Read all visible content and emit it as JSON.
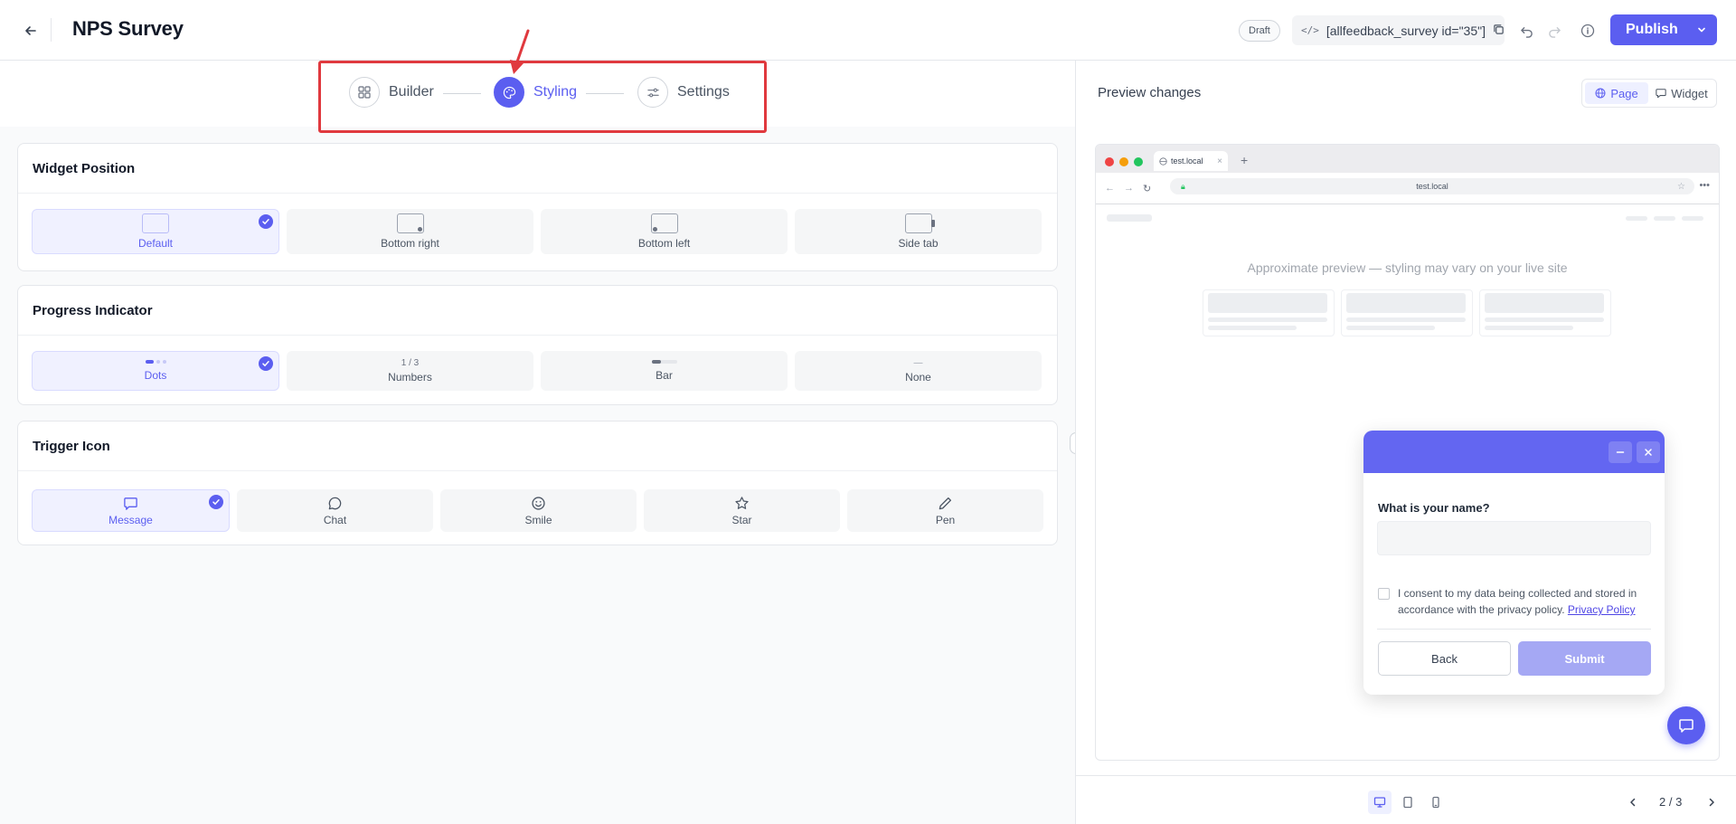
{
  "header": {
    "title": "NPS Survey",
    "status_badge": "Draft",
    "shortcode": "[allfeedback_survey id=\"35\"]",
    "publish_label": "Publish"
  },
  "steps": [
    {
      "label": "Builder",
      "icon": "grid-icon",
      "active": false
    },
    {
      "label": "Styling",
      "icon": "palette-icon",
      "active": true
    },
    {
      "label": "Settings",
      "icon": "sliders-icon",
      "active": false
    }
  ],
  "widget_position": {
    "title": "Widget Position",
    "options": [
      {
        "label": "Default",
        "selected": true
      },
      {
        "label": "Bottom right",
        "selected": false
      },
      {
        "label": "Bottom left",
        "selected": false
      },
      {
        "label": "Side tab",
        "selected": false
      }
    ]
  },
  "progress_indicator": {
    "title": "Progress Indicator",
    "options": [
      {
        "label": "Dots",
        "selected": true
      },
      {
        "label": "Numbers",
        "sample": "1 / 3",
        "selected": false
      },
      {
        "label": "Bar",
        "selected": false
      },
      {
        "label": "None",
        "sample": "—",
        "selected": false
      }
    ]
  },
  "trigger_icon": {
    "title": "Trigger Icon",
    "options": [
      {
        "label": "Message",
        "icon": "message-icon",
        "selected": true
      },
      {
        "label": "Chat",
        "icon": "chat-icon",
        "selected": false
      },
      {
        "label": "Smile",
        "icon": "smile-icon",
        "selected": false
      },
      {
        "label": "Star",
        "icon": "star-icon",
        "selected": false
      },
      {
        "label": "Pen",
        "icon": "pen-icon",
        "selected": false
      }
    ]
  },
  "preview": {
    "title": "Preview changes",
    "toggle": [
      {
        "label": "Page",
        "active": true
      },
      {
        "label": "Widget",
        "active": false
      }
    ],
    "browser": {
      "tab_title": "test.local",
      "url": "test.local",
      "notice": "Approximate preview — styling may vary on your live site"
    },
    "widget": {
      "question": "What is your name?",
      "consent_text": "I consent to my data being collected and stored in accordance with the privacy policy.",
      "privacy_link": "Privacy Policy",
      "back_label": "Back",
      "submit_label": "Submit"
    },
    "pager": "2 / 3"
  },
  "colors": {
    "accent": "#5b5ef0",
    "widget_header": "#6366f1",
    "highlight": "#e0393e"
  }
}
